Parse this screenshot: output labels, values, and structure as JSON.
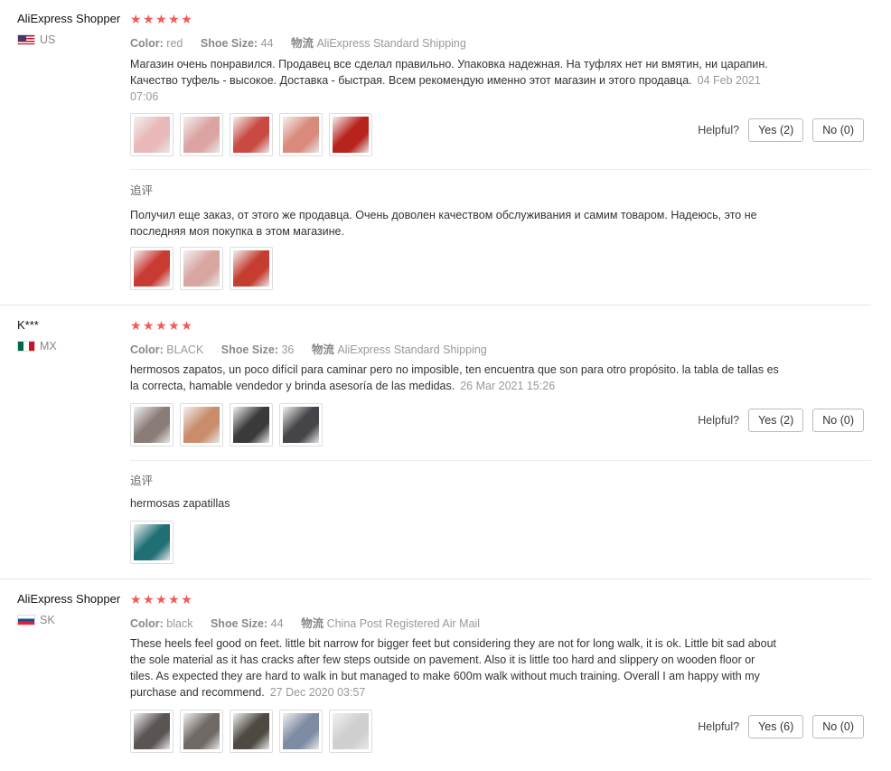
{
  "helpful_label": "Helpful?",
  "additional_label": "追评",
  "star_glyph": "★★★★★",
  "meta_labels": {
    "color": "Color:",
    "size": "Shoe Size:",
    "shipping": "物流"
  },
  "reviews": [
    {
      "user": "AliExpress Shopper",
      "country": "US",
      "color": "red",
      "size": "44",
      "shipping": "AliExpress Standard Shipping",
      "text": "Магазин очень понравился. Продавец все сделал правильно. Упаковка надежная. На туфлях нет ни вмятин, ни царапин. Качество туфель - высокое. Доставка - быстрая. Всем рекомендую именно этот магазин и этого продавца.",
      "date": "04 Feb 2021 07:06",
      "yes": "Yes (2)",
      "no": "No (0)",
      "additional_text": "Получил еще заказ, от этого же продавца. Очень доволен качеством обслуживания и самим товаром. Надеюсь, это не последняя моя покупка в этом магазине."
    },
    {
      "user": "K***",
      "country": "MX",
      "color": "BLACK",
      "size": "36",
      "shipping": "AliExpress Standard Shipping",
      "text": "hermosos zapatos, un poco difícil para caminar pero no imposible, ten encuentra que son para otro propósito. la tabla de tallas es la correcta, hamable vendedor y brinda asesoría de las medidas.",
      "date": "26 Mar 2021 15:26",
      "yes": "Yes (2)",
      "no": "No (0)",
      "additional_text": "hermosas zapatillas"
    },
    {
      "user": "AliExpress Shopper",
      "country": "SK",
      "color": "black",
      "size": "44",
      "shipping": "China Post Registered Air Mail",
      "text": "These heels feel good on feet. little bit narrow for bigger feet but considering they are not for long walk, it is ok. Little bit sad about the sole material as it has cracks after few steps outside on pavement. Also it is little too hard and slippery on wooden floor or tiles. As expected they are hard to walk in but managed to make 600m walk without much training. Overall I am happy with my purchase and recommend.",
      "date": "27 Dec 2020 03:57",
      "yes": "Yes (6)",
      "no": "No (0)"
    }
  ],
  "thumb_colors": {
    "r1": [
      "#e9b8b8",
      "#dca3a3",
      "#c94a42",
      "#d98a7a",
      "#b8231c"
    ],
    "r1a": [
      "#c93a32",
      "#d9a5a0",
      "#c43d30"
    ],
    "r2": [
      "#8a7d78",
      "#c98d6c",
      "#3a3a3a",
      "#444449"
    ],
    "r2a": [
      "#1f6f74"
    ],
    "r3": [
      "#5a5553",
      "#6f6a66",
      "#4e4a42",
      "#7d8ba3",
      "#cfcfcf"
    ]
  }
}
